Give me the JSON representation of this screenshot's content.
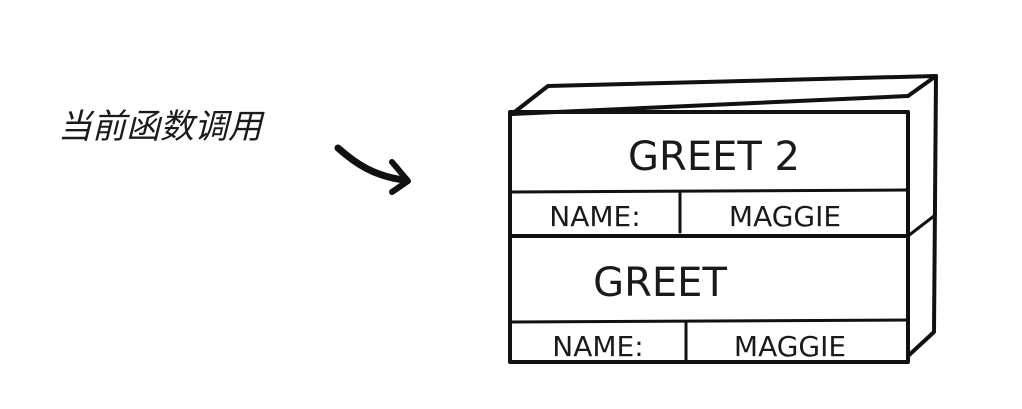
{
  "annotation": {
    "text": "当前函数调用"
  },
  "stack": {
    "frames": [
      {
        "function_name": "GREET 2",
        "var_label": "NAME:",
        "var_value": "MAGGIE"
      },
      {
        "function_name": "GREET",
        "var_label": "NAME:",
        "var_value": "MAGGIE"
      }
    ]
  }
}
